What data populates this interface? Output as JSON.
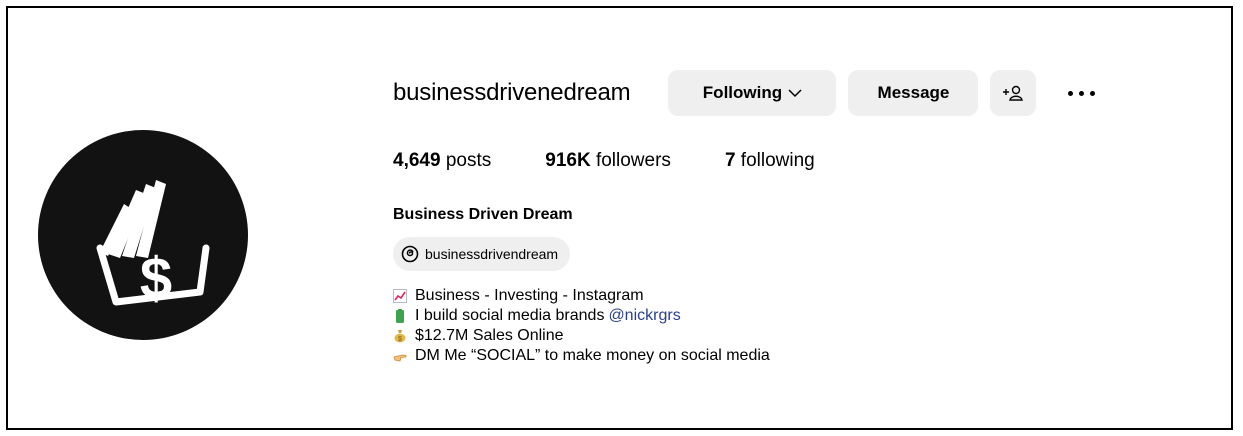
{
  "profile": {
    "username": "businessdrivenedream",
    "following_button": "Following",
    "message_button": "Message",
    "posts_count": "4,649",
    "posts_label": "posts",
    "followers_count": "916K",
    "followers_label": "followers",
    "following_count": "7",
    "following_label": "following",
    "full_name": "Business Driven Dream",
    "threads_handle": "businessdrivendream",
    "bio": [
      {
        "icon": "chart-increasing-emoji",
        "text": "Business - Investing - Instagram"
      },
      {
        "icon": "battery-emoji",
        "text": "I build social media brands",
        "mention": "@nickrgrs"
      },
      {
        "icon": "money-bag-emoji",
        "text": "$12.7M Sales Online"
      },
      {
        "icon": "pointing-hand-emoji",
        "text": "DM Me “SOCIAL” to make money on social media"
      }
    ]
  },
  "colors": {
    "button_bg": "#efefef",
    "mention": "#2a3f8f",
    "avatar_bg": "#121212"
  }
}
